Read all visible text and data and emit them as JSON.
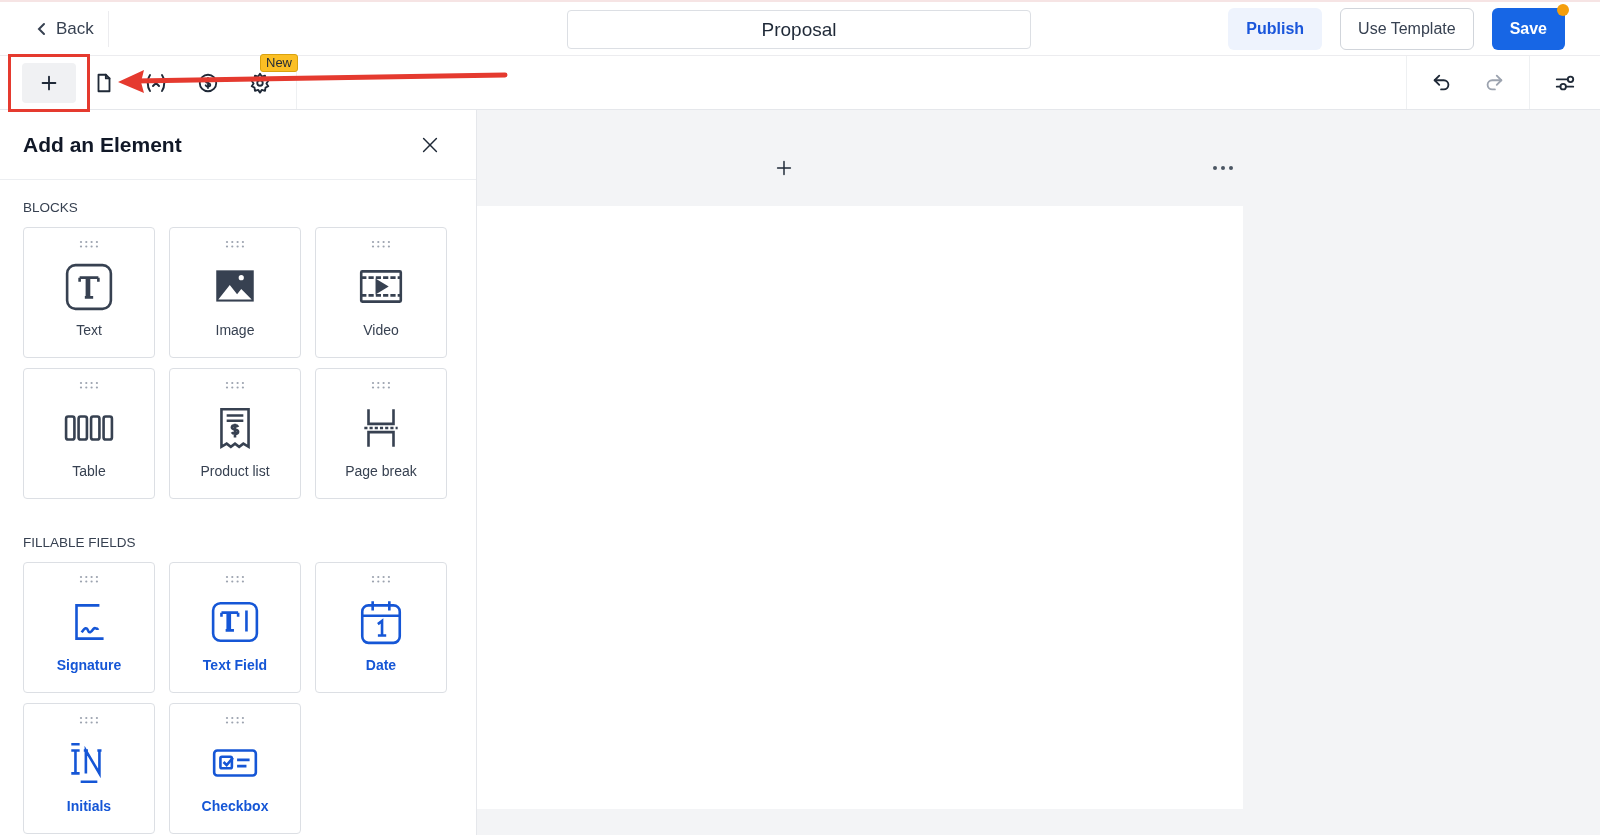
{
  "header": {
    "back": "Back",
    "title": "Proposal",
    "buttons": [
      {
        "label": "Publish",
        "kind": "soft",
        "dot": false
      },
      {
        "label": "Use Template",
        "kind": "outline",
        "dot": false
      },
      {
        "label": "Save",
        "kind": "primary",
        "dot": true
      }
    ]
  },
  "toolbar": {
    "tools": [
      {
        "kind": "plus",
        "selected": true
      },
      {
        "kind": "document",
        "selected": false
      },
      {
        "kind": "variable",
        "selected": false
      },
      {
        "kind": "dollar",
        "selected": false
      },
      {
        "kind": "gear",
        "selected": false,
        "badge": "New"
      }
    ],
    "undo": {
      "disabled": false
    },
    "redo": {
      "disabled": true
    }
  },
  "panel": {
    "title": "Add an Element",
    "sections": [
      {
        "heading": "BLOCKS",
        "kind": "block",
        "items": [
          {
            "label": "Text",
            "kind": "text"
          },
          {
            "label": "Image",
            "kind": "image"
          },
          {
            "label": "Video",
            "kind": "video"
          },
          {
            "label": "Table",
            "kind": "table"
          },
          {
            "label": "Product list",
            "kind": "product"
          },
          {
            "label": "Page break",
            "kind": "pagebreak"
          }
        ]
      },
      {
        "heading": "FILLABLE FIELDS",
        "kind": "field",
        "items": [
          {
            "label": "Signature",
            "kind": "signature"
          },
          {
            "label": "Text Field",
            "kind": "textfield"
          },
          {
            "label": "Date",
            "kind": "date"
          },
          {
            "label": "Initials",
            "kind": "initials"
          },
          {
            "label": "Checkbox",
            "kind": "checkbox"
          }
        ]
      }
    ]
  },
  "annotation": {
    "shown": true
  }
}
